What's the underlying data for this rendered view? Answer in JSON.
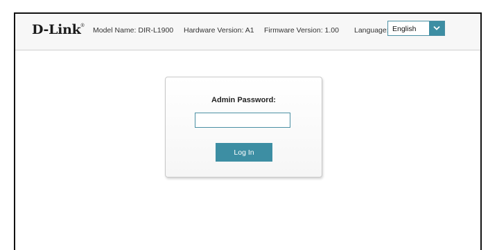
{
  "header": {
    "logo_text": "D-Link",
    "logo_mark": "®",
    "model": "Model Name: DIR-L1900",
    "hardware": "Hardware Version: A1",
    "firmware": "Firmware Version: 1.00",
    "language_label": "Language:",
    "language_value": "English",
    "language_icon": "chevron-down-icon"
  },
  "login": {
    "title": "Admin Password:",
    "password_value": "",
    "button_label": "Log In"
  },
  "colors": {
    "accent": "#3d8ea3",
    "header_bg": "#f7f7f7"
  }
}
